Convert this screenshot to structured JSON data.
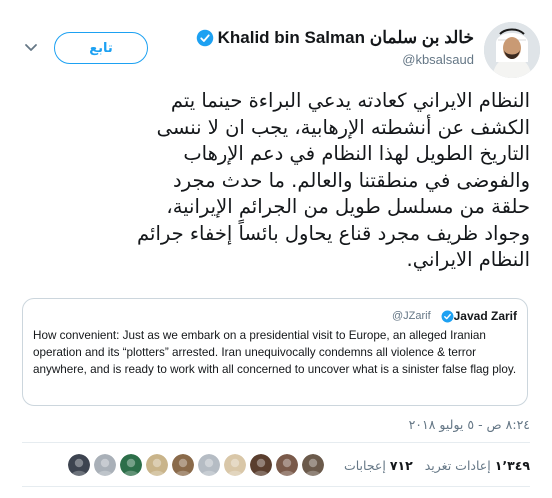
{
  "header": {
    "display_name": "Khalid bin Salman خالد بن سلمان",
    "username": "@kbsalsaud",
    "follow_label": "تابع"
  },
  "tweet": {
    "lines": [
      "النظام الايراني كعادته يدعي البراءة حينما يتم",
      "الكشف عن أنشطته الإرهابية، يجب ان لا ننسى",
      "التاريخ الطويل لهذا النظام في دعم الإرهاب",
      "والفوضى في منطقتنا والعالم. ما حدث مجرد",
      "حلقة من مسلسل طويل من الجرائم الإيرانية،",
      "وجواد ظريف مجرد قناع يحاول بائساً إخفاء جرائم",
      "النظام الايراني."
    ]
  },
  "quote": {
    "name": "Javad Zarif",
    "handle": "@JZarif",
    "text": "How convenient: Just as we embark on a presidential visit to Europe, an alleged Iranian operation and its “plotters” arrested. Iran unequivocally condemns all violence & terror anywhere, and is ready to work with all concerned to uncover what is a sinister false flag ploy."
  },
  "timestamp": "٨:٢٤ ص - ٥ يوليو ٢٠١٨",
  "stats": {
    "retweets_count": "١٬٣٤٩",
    "retweets_label": "إعادات تغريد",
    "likes_count": "٧١٢",
    "likes_label": "إعجابات"
  },
  "likers": [
    {
      "color": "#3d4450"
    },
    {
      "color": "#a9b0b8"
    },
    {
      "color": "#2c6e49"
    },
    {
      "color": "#c9b48a"
    },
    {
      "color": "#8a6a4a"
    },
    {
      "color": "#b5bcc4"
    },
    {
      "color": "#d9c7a8"
    },
    {
      "color": "#5a3e2e"
    },
    {
      "color": "#7a5a4a"
    },
    {
      "color": "#6b5a4b"
    }
  ],
  "colors": {
    "accent": "#1da1f2",
    "secondary_text": "#657786",
    "border": "#ccd6dd"
  }
}
